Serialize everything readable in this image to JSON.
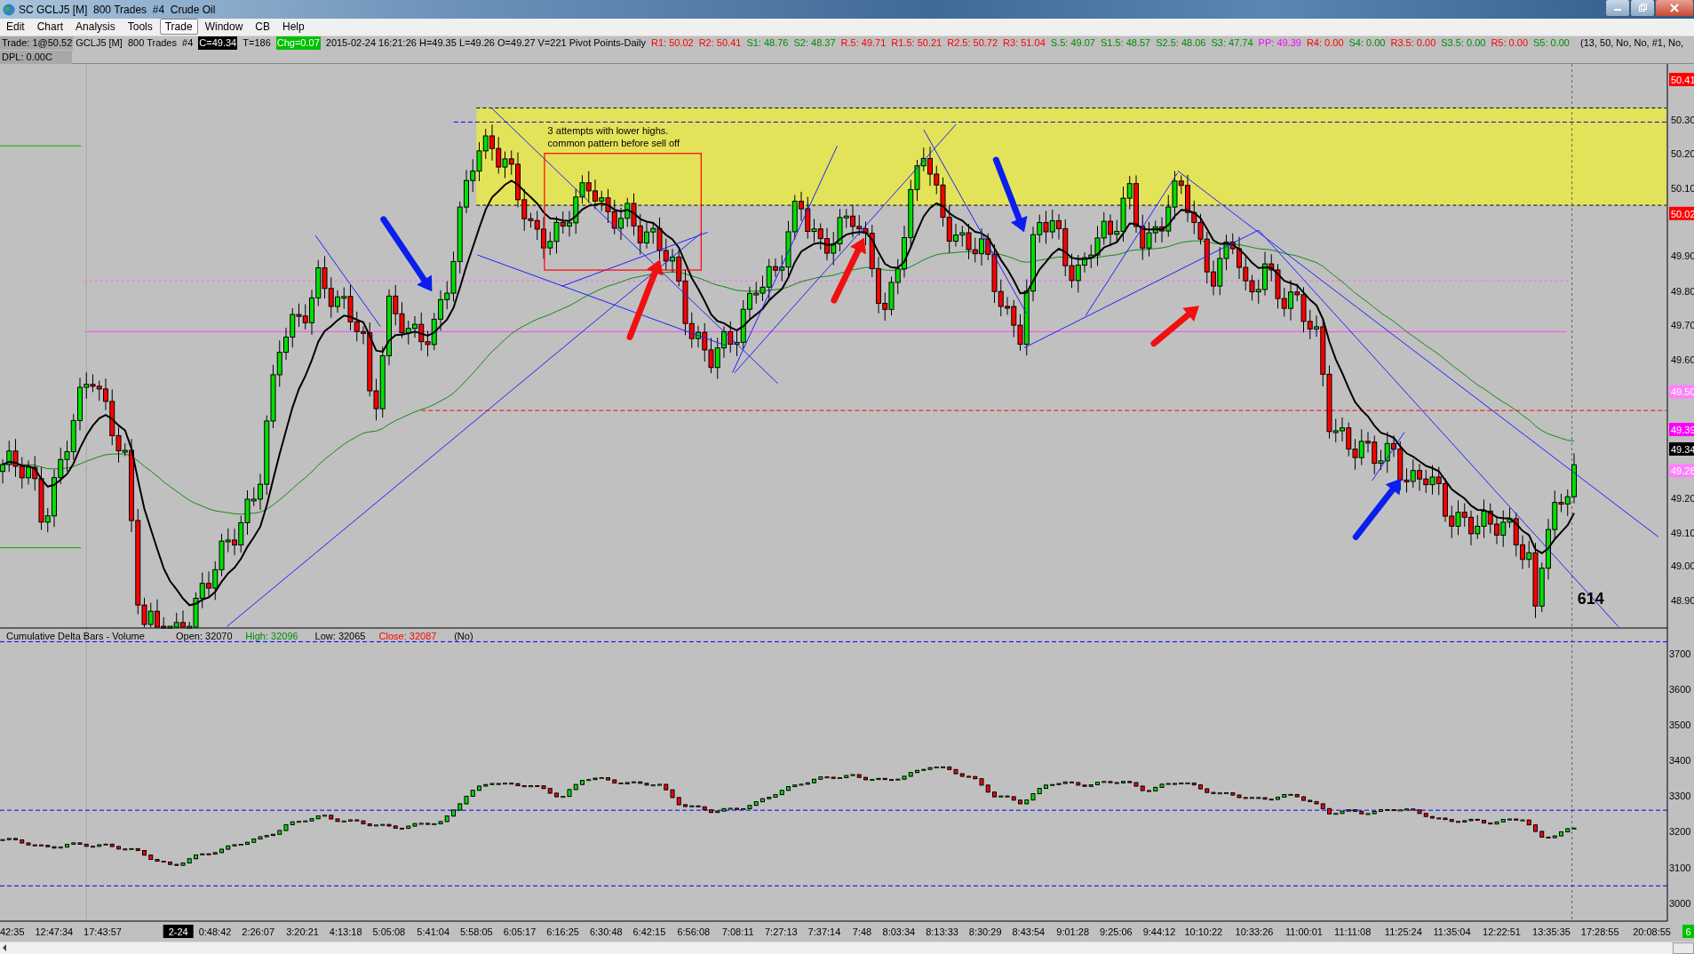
{
  "window": {
    "title": "SC GCLJ5 [M]  800 Trades  #4  Crude Oil"
  },
  "menu": {
    "items": [
      {
        "label": "Edit",
        "selected": false
      },
      {
        "label": "Chart",
        "selected": false
      },
      {
        "label": "Analysis",
        "selected": false
      },
      {
        "label": "Tools",
        "selected": false
      },
      {
        "label": "Trade",
        "selected": true
      },
      {
        "label": "Window",
        "selected": false
      },
      {
        "label": "CB",
        "selected": false
      },
      {
        "label": "Help",
        "selected": false
      }
    ]
  },
  "info": {
    "trade": "Trade: 1@50.52",
    "dpl": "DPL: 0.00C",
    "params": "(13, 50, No, No, #1, No,",
    "items": [
      {
        "kind": "plain",
        "text": "GCLJ5 [M]  800 Trades  #4"
      },
      {
        "kind": "badge",
        "color": "#000000",
        "text": "C=49.34"
      },
      {
        "kind": "plain",
        "text": "T=186"
      },
      {
        "kind": "badge",
        "color": "#00c000",
        "text": "Chg=0.07"
      },
      {
        "kind": "plain",
        "text": "2015-02-24 16:21:26 H=49.35 L=49.26 O=49.27 V=221 Pivot Points-Daily"
      },
      {
        "kind": "colored",
        "color": "#ff0000",
        "text": "R1: 50.02"
      },
      {
        "kind": "colored",
        "color": "#ff0000",
        "text": "R2: 50.41"
      },
      {
        "kind": "colored",
        "color": "#008c00",
        "text": "S1: 48.76"
      },
      {
        "kind": "colored",
        "color": "#008c00",
        "text": "S2: 48.37"
      },
      {
        "kind": "colored",
        "color": "#ff0000",
        "text": "R.5: 49.71"
      },
      {
        "kind": "colored",
        "color": "#ff0000",
        "text": "R1.5: 50.21"
      },
      {
        "kind": "colored",
        "color": "#ff0000",
        "text": "R2.5: 50.72"
      },
      {
        "kind": "colored",
        "color": "#ff0000",
        "text": "R3: 51.04"
      },
      {
        "kind": "colored",
        "color": "#008c00",
        "text": "S.5: 49.07"
      },
      {
        "kind": "colored",
        "color": "#008c00",
        "text": "S1.5: 48.57"
      },
      {
        "kind": "colored",
        "color": "#008c00",
        "text": "S2.5: 48.06"
      },
      {
        "kind": "colored",
        "color": "#008c00",
        "text": "S3: 47.74"
      },
      {
        "kind": "colored",
        "color": "#ff00ff",
        "text": "PP: 49.39"
      },
      {
        "kind": "colored",
        "color": "#ff0000",
        "text": "R4: 0.00"
      },
      {
        "kind": "colored",
        "color": "#008c00",
        "text": "S4: 0.00"
      },
      {
        "kind": "colored",
        "color": "#ff0000",
        "text": "R3.5: 0.00"
      },
      {
        "kind": "colored",
        "color": "#008c00",
        "text": "S3.5: 0.00"
      },
      {
        "kind": "colored",
        "color": "#ff0000",
        "text": "R5: 0.00"
      },
      {
        "kind": "colored",
        "color": "#008c00",
        "text": "S5: 0.00"
      }
    ]
  },
  "chart": {
    "note": [
      "3 attempts with lower highs.",
      "common pattern before sell off"
    ],
    "count_label": "614"
  },
  "price_axis": [
    {
      "kind": "badge",
      "color": "#ff0000",
      "text": "50.41"
    },
    {
      "kind": "plain",
      "text": "50.30"
    },
    {
      "kind": "plain",
      "text": "50.20"
    },
    {
      "kind": "plain",
      "text": "50.10"
    },
    {
      "kind": "badge",
      "color": "#ff0000",
      "text": "50.02"
    },
    {
      "kind": "plain",
      "text": "49.90"
    },
    {
      "kind": "plain",
      "text": "49.80"
    },
    {
      "kind": "plain",
      "text": "49.70"
    },
    {
      "kind": "plain",
      "text": "49.60"
    },
    {
      "kind": "badge",
      "color": "#ff80ff",
      "text": "49.50"
    },
    {
      "kind": "badge",
      "color": "#ff00ff",
      "text": "49.39"
    },
    {
      "kind": "badge",
      "color": "#000000",
      "text": "49.34"
    },
    {
      "kind": "badge",
      "color": "#ff80ff",
      "text": "49.28"
    },
    {
      "kind": "plain",
      "text": "49.20"
    },
    {
      "kind": "plain",
      "text": "49.10"
    },
    {
      "kind": "plain",
      "text": "49.00"
    },
    {
      "kind": "plain",
      "text": "48.90"
    }
  ],
  "lower_panel": {
    "title": "Cumulative Delta Bars - Volume",
    "stats": [
      {
        "text": "Open: 32070",
        "color": "#000000"
      },
      {
        "text": "High: 32096",
        "color": "#008c00"
      },
      {
        "text": "Low: 32065",
        "color": "#000000"
      },
      {
        "text": "Close: 32087",
        "color": "#ff0000"
      },
      {
        "text": "(No)",
        "color": "#000000"
      }
    ],
    "axis": [
      "3700",
      "3600",
      "3500",
      "3400",
      "3300",
      "3200",
      "3100",
      "3000"
    ]
  },
  "time_axis": [
    {
      "kind": "plain",
      "text": "42:35"
    },
    {
      "kind": "plain",
      "text": "12:47:34"
    },
    {
      "kind": "plain",
      "text": "17:43:57"
    },
    {
      "kind": "badge",
      "color": "#000000",
      "text": "2-24"
    },
    {
      "kind": "plain",
      "text": "0:48:42"
    },
    {
      "kind": "plain",
      "text": "2:26:07"
    },
    {
      "kind": "plain",
      "text": "3:20:21"
    },
    {
      "kind": "plain",
      "text": "4:13:18"
    },
    {
      "kind": "plain",
      "text": "5:05:08"
    },
    {
      "kind": "plain",
      "text": "5:41:04"
    },
    {
      "kind": "plain",
      "text": "5:58:05"
    },
    {
      "kind": "plain",
      "text": "6:05:17"
    },
    {
      "kind": "plain",
      "text": "6:16:25"
    },
    {
      "kind": "plain",
      "text": "6:30:48"
    },
    {
      "kind": "plain",
      "text": "6:42:15"
    },
    {
      "kind": "plain",
      "text": "6:56:08"
    },
    {
      "kind": "plain",
      "text": "7:08:11"
    },
    {
      "kind": "plain",
      "text": "7:27:13"
    },
    {
      "kind": "plain",
      "text": "7:37:14"
    },
    {
      "kind": "plain",
      "text": "7:48"
    },
    {
      "kind": "plain",
      "text": "8:03:34"
    },
    {
      "kind": "plain",
      "text": "8:13:33"
    },
    {
      "kind": "plain",
      "text": "8:30:29"
    },
    {
      "kind": "plain",
      "text": "8:43:54"
    },
    {
      "kind": "plain",
      "text": "9:01:28"
    },
    {
      "kind": "plain",
      "text": "9:25:06"
    },
    {
      "kind": "plain",
      "text": "9:44:12"
    },
    {
      "kind": "plain",
      "text": "10:10:22"
    },
    {
      "kind": "plain",
      "text": "10:33:26"
    },
    {
      "kind": "plain",
      "text": "11:00:01"
    },
    {
      "kind": "plain",
      "text": "11:11:08"
    },
    {
      "kind": "plain",
      "text": "11:25:24"
    },
    {
      "kind": "plain",
      "text": "11:35:04"
    },
    {
      "kind": "plain",
      "text": "12:22:51"
    },
    {
      "kind": "plain",
      "text": "13:35:35"
    },
    {
      "kind": "plain",
      "text": "17:28:55"
    },
    {
      "kind": "plain",
      "text": "20:08:55"
    },
    {
      "kind": "badge",
      "color": "#00c000",
      "text": "6"
    }
  ]
}
